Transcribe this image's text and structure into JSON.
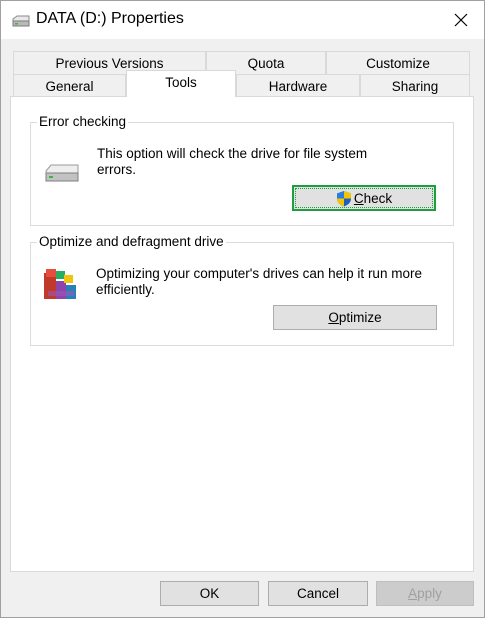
{
  "window": {
    "title": "DATA (D:) Properties"
  },
  "tabs": {
    "row_top": [
      "Previous Versions",
      "Quota",
      "Customize"
    ],
    "row_bottom": [
      "General",
      "Tools",
      "Hardware",
      "Sharing"
    ],
    "active": "Tools"
  },
  "error_checking": {
    "title": "Error checking",
    "description_line1": "This option will check the drive for file system",
    "description_line2": "errors.",
    "button_accel": "C",
    "button_rest": "heck",
    "drive_icon": "hard-drive-icon",
    "shield_icon": "uac-shield-icon"
  },
  "optimize": {
    "title": "Optimize and defragment drive",
    "description_line1": "Optimizing your computer's drives can help it run more",
    "description_line2": "efficiently.",
    "button_accel": "O",
    "button_rest": "ptimize",
    "defrag_icon": "defrag-icon"
  },
  "footer": {
    "ok_label": "OK",
    "cancel_label": "Cancel",
    "apply_accel": "A",
    "apply_rest": "pply"
  },
  "colors": {
    "accent": "#0078d7",
    "focus": "#1e9e3e"
  }
}
